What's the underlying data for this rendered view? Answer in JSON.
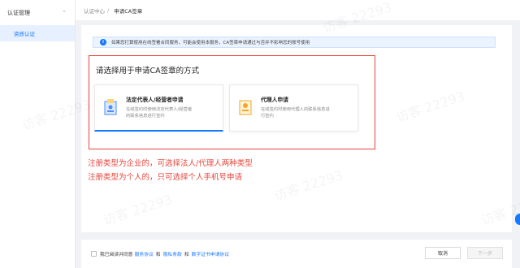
{
  "sidebar": {
    "group_label": "认证管理",
    "items": [
      {
        "label": "资质认证"
      }
    ]
  },
  "breadcrumb": {
    "parent": "认证中心",
    "separator": "/",
    "current": "申请CA签章"
  },
  "notice": {
    "text": "如果您打算使用在线签署合同服务，可能会使用本服务，CA签章申请通过与否并不影响您的账号使用"
  },
  "choose": {
    "title": "请选择用于申请CA签章的方式",
    "cards": [
      {
        "title": "法定代表人/经营者申请",
        "desc1": "在线签约时使用法定代表人/经营者",
        "desc2": "的联系信息进行签约"
      },
      {
        "title": "代理人申请",
        "desc1": "在线签约时使用代理人的联系信息进",
        "desc2": "行签约"
      }
    ]
  },
  "notes": {
    "line1": "注册类型为企业的，可选择法人/代理人两种类型",
    "line2": "注册类型为个人的，只可选择个人手机号申请"
  },
  "footer": {
    "agree_prefix": "我已阅读并同意",
    "link1": "服务协议",
    "and1": "和",
    "link2": "隐私条款",
    "and2": "和",
    "link3": "数字证书申请协议",
    "cancel": "取消",
    "next": "下一步"
  },
  "watermark": "访客 22293",
  "colors": {
    "accent": "#1677ff",
    "alert": "#e8453c"
  }
}
